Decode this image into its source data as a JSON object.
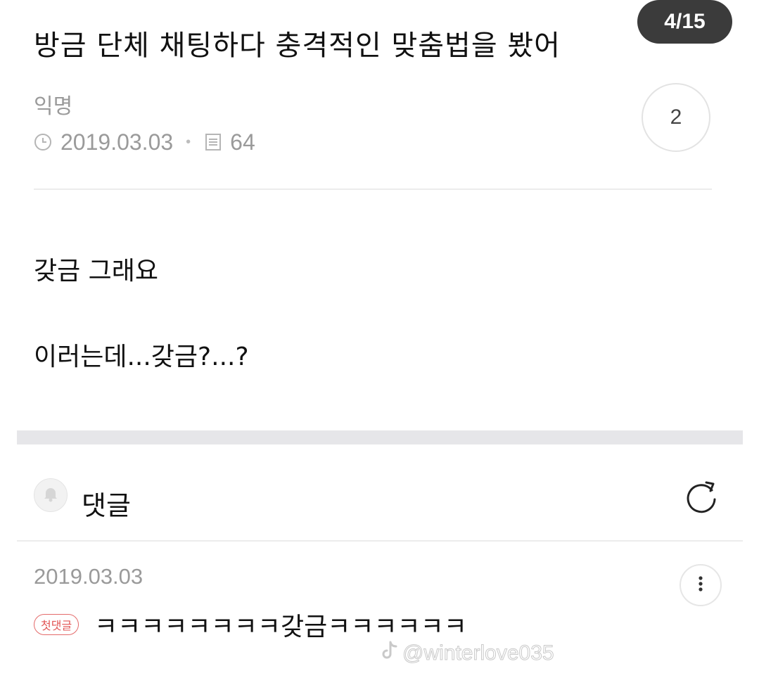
{
  "page_counter": "4/15",
  "post": {
    "title": "방금 단체 채팅하다 충격적인 맞춤법을 봤어",
    "author": "익명",
    "date": "2019.03.03",
    "views": "64",
    "comment_count": "2",
    "body_lines": [
      "갖금 그래요",
      "이러는데...갖금?...?"
    ]
  },
  "comments_section": {
    "label": "댓글"
  },
  "comment": {
    "date": "2019.03.03",
    "badge": "첫댓글",
    "text": "ㅋㅋㅋㅋㅋㅋㅋㅋ갖금ㅋㅋㅋㅋㅋㅋ"
  },
  "watermark": "@winterlove035",
  "icons": [
    "clock-icon",
    "document-icon",
    "bell-icon",
    "refresh-icon",
    "more-vertical-icon",
    "tiktok-icon"
  ],
  "colors": {
    "badge": "#e25555",
    "meta_gray": "#9a9a9a",
    "counter_bg": "#3b3b3b"
  }
}
